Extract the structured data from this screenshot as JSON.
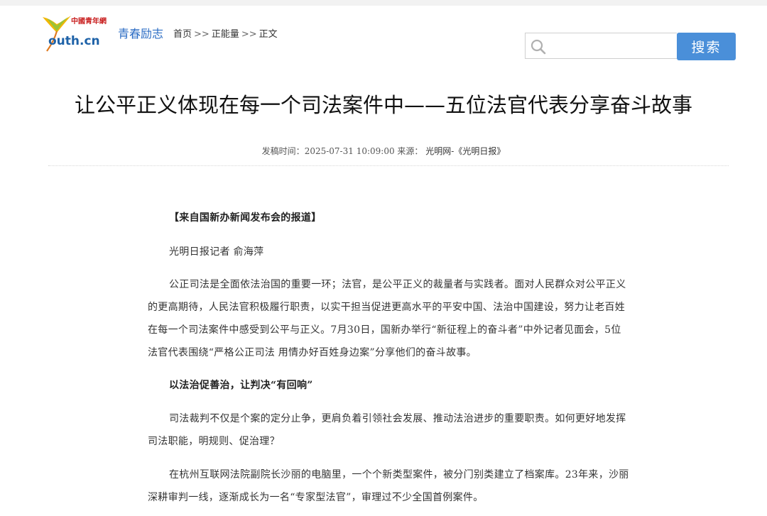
{
  "header": {
    "logo_cn": "中國青年網",
    "logo_en": "outh.cn",
    "channel": "青春励志",
    "breadcrumb": [
      "首页",
      "正能量",
      "正文"
    ],
    "breadcrumb_sep": ">>",
    "search": {
      "placeholder": "",
      "value": "",
      "button_label": "搜索"
    }
  },
  "article": {
    "title": "让公平正义体现在每一个司法案件中——五位法官代表分享奋斗故事",
    "meta": {
      "time_label": "发稿时间：",
      "time_value": "2025-07-31 10:09:00",
      "source_label": "来源：",
      "source_value": "光明网-《光明日报》"
    },
    "paragraphs": [
      {
        "text": "【来自国新办新闻发布会的报道】",
        "bold": true
      },
      {
        "text": "光明日报记者 俞海萍",
        "bold": false
      },
      {
        "text": "公正司法是全面依法治国的重要一环；法官，是公平正义的裁量者与实践者。面对人民群众对公平正义的更高期待，人民法官积极履行职责，以实干担当促进更高水平的平安中国、法治中国建设，努力让老百姓在每一个司法案件中感受到公平与正义。7月30日，国新办举行“新征程上的奋斗者”中外记者见面会，5位法官代表围绕“严格公正司法 用情办好百姓身边案”分享他们的奋斗故事。",
        "bold": false
      },
      {
        "text": "以法治促善治，让判决“有回响”",
        "bold": true
      },
      {
        "text": "司法裁判不仅是个案的定分止争，更肩负着引领社会发展、推动法治进步的重要职责。如何更好地发挥司法职能，明规则、促治理？",
        "bold": false
      },
      {
        "text": "在杭州互联网法院副院长沙丽的电脑里，一个个新类型案件，被分门别类建立了档案库。23年来，沙丽深耕审判一线，逐渐成长为一名“专家型法官”，审理过不少全国首例案件。",
        "bold": false
      }
    ]
  },
  "colors": {
    "accent_blue": "#4a8fd9",
    "channel_blue": "#2b6cc4",
    "logo_red": "#c81e1e",
    "logo_yellow": "#f2b705"
  },
  "icons": {
    "logo": "ginkgo-leaf-logo",
    "search": "search-icon"
  }
}
